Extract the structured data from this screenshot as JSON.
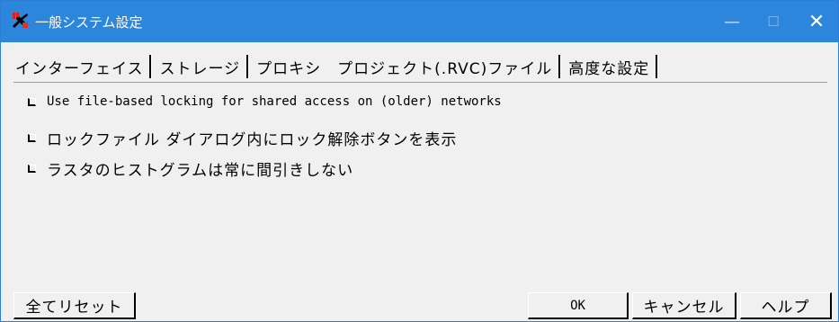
{
  "window": {
    "title": "一般システム設定",
    "accent_color": "#2b86dc",
    "icon": "app-tool-icon",
    "controls": {
      "minimize": "—",
      "maximize": "☐",
      "close": "✕"
    }
  },
  "tabs": [
    {
      "label": "インターフェイス"
    },
    {
      "label": "ストレージ"
    },
    {
      "label": "プロキシ"
    },
    {
      "label": "プロジェクト(.RVC)ファイル",
      "selected": true
    },
    {
      "label": "高度な設定"
    }
  ],
  "options": [
    {
      "label": "Use file-based locking for shared access on (older) networks",
      "checked": false
    },
    {
      "label": "ロックファイル ダイアログ内にロック解除ボタンを表示",
      "checked": false
    },
    {
      "label": "ラスタのヒストグラムは常に間引きしない",
      "checked": false
    }
  ],
  "buttons": {
    "reset": "全てリセット",
    "ok": "OK",
    "cancel": "キャンセル",
    "help": "ヘルプ"
  }
}
